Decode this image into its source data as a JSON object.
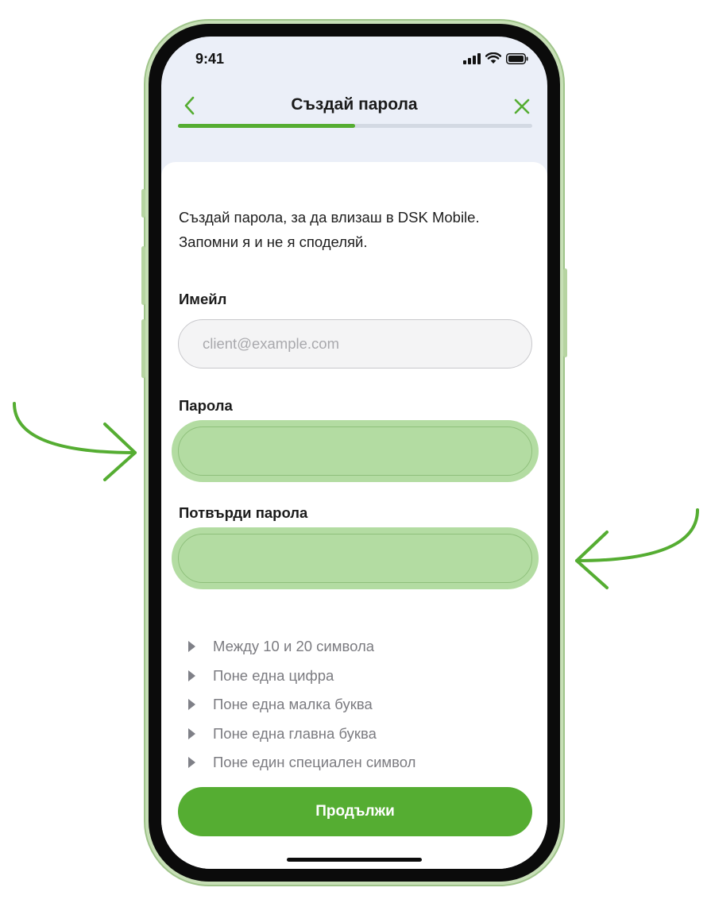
{
  "status_bar": {
    "time": "9:41",
    "icons": [
      "cellular-signal-icon",
      "wifi-icon",
      "battery-icon"
    ]
  },
  "header": {
    "title": "Създай парола",
    "back_icon": "chevron-left-icon",
    "close_icon": "close-icon",
    "progress": 0.5
  },
  "intro_text": "Създай парола, за да влизаш в DSK Mobile. Запомни я и не я споделяй.",
  "form": {
    "email": {
      "label": "Имейл",
      "placeholder": "client@example.com",
      "value": ""
    },
    "password": {
      "label": "Парола",
      "value": ""
    },
    "confirm_password": {
      "label": "Потвърди парола",
      "value": ""
    }
  },
  "requirements": [
    "Между 10 и 20 символа",
    "Поне една цифра",
    "Поне една малка буква",
    "Поне една главна буква",
    "Поне един специален символ"
  ],
  "continue_button": {
    "label": "Продължи"
  },
  "colors": {
    "accent": "#55ad32",
    "highlight": "#b3dca2",
    "screen_background": "#ebeff8",
    "text_primary": "#1d1d1d",
    "text_muted": "#7b7b80"
  }
}
